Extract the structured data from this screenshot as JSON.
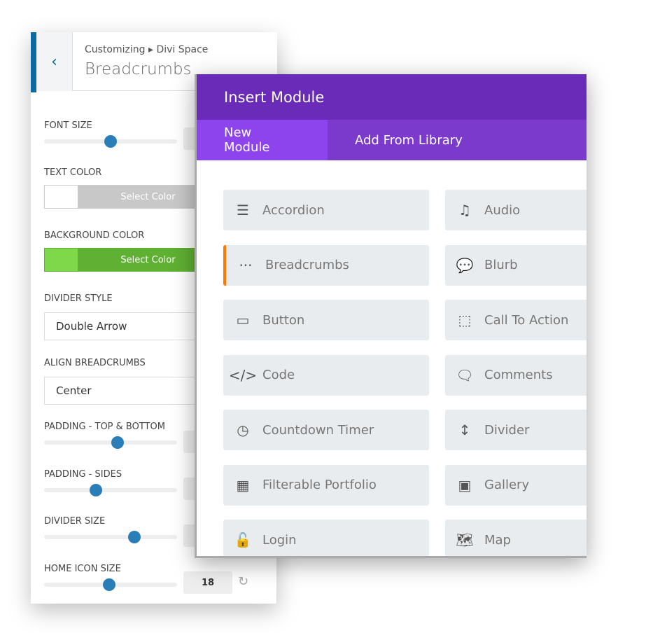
{
  "customizer": {
    "back_icon": "chevron-left-icon",
    "breadcrumb": "Customizing ▸ Divi Space",
    "title": "Breadcrumbs",
    "font_size": {
      "label": "FONT SIZE",
      "value_fraction": 0.5
    },
    "text_color": {
      "label": "TEXT COLOR",
      "button": "Select Color",
      "swatch": "#ffffff"
    },
    "background_color": {
      "label": "BACKGROUND COLOR",
      "button": "Select Color",
      "swatch": "#7ed84a",
      "button_color": "#5fb033"
    },
    "divider_style": {
      "label": "DIVIDER STYLE",
      "value": "Double Arrow"
    },
    "align": {
      "label": "ALIGN BREADCRUMBS",
      "value": "Center"
    },
    "padding_tb": {
      "label": "PADDING - TOP & BOTTOM",
      "value_fraction": 0.55
    },
    "padding_sides": {
      "label": "PADDING - SIDES",
      "value_fraction": 0.39
    },
    "divider_size": {
      "label": "DIVIDER SIZE",
      "value_fraction": 0.68
    },
    "home_icon_size": {
      "label": "HOME ICON SIZE",
      "value_fraction": 0.49,
      "value": "18"
    }
  },
  "modal": {
    "title": "Insert Module",
    "tabs": [
      "New Module",
      "Add From Library"
    ],
    "accent": "#6a2bb8",
    "modules": [
      {
        "label": "Accordion",
        "icon": "accordion-icon",
        "glyph": "☰"
      },
      {
        "label": "Audio",
        "icon": "music-note-icon",
        "glyph": "♫"
      },
      {
        "label": "Breadcrumbs",
        "icon": "dots-icon",
        "glyph": "···"
      },
      {
        "label": "Blurb",
        "icon": "speech-bubble-icon",
        "glyph": "💬"
      },
      {
        "label": "Button",
        "icon": "button-icon",
        "glyph": "▭"
      },
      {
        "label": "Call To Action",
        "icon": "cursor-click-icon",
        "glyph": "⬚"
      },
      {
        "label": "Code",
        "icon": "code-icon",
        "glyph": "</>"
      },
      {
        "label": "Comments",
        "icon": "comments-icon",
        "glyph": "🗨"
      },
      {
        "label": "Countdown Timer",
        "icon": "timer-icon",
        "glyph": "◷"
      },
      {
        "label": "Divider",
        "icon": "divider-icon",
        "glyph": "↕"
      },
      {
        "label": "Filterable Portfolio",
        "icon": "grid-icon",
        "glyph": "▦"
      },
      {
        "label": "Gallery",
        "icon": "gallery-icon",
        "glyph": "▣"
      },
      {
        "label": "Login",
        "icon": "lock-icon",
        "glyph": "🔓"
      },
      {
        "label": "Map",
        "icon": "map-icon",
        "glyph": "🗺"
      }
    ]
  }
}
